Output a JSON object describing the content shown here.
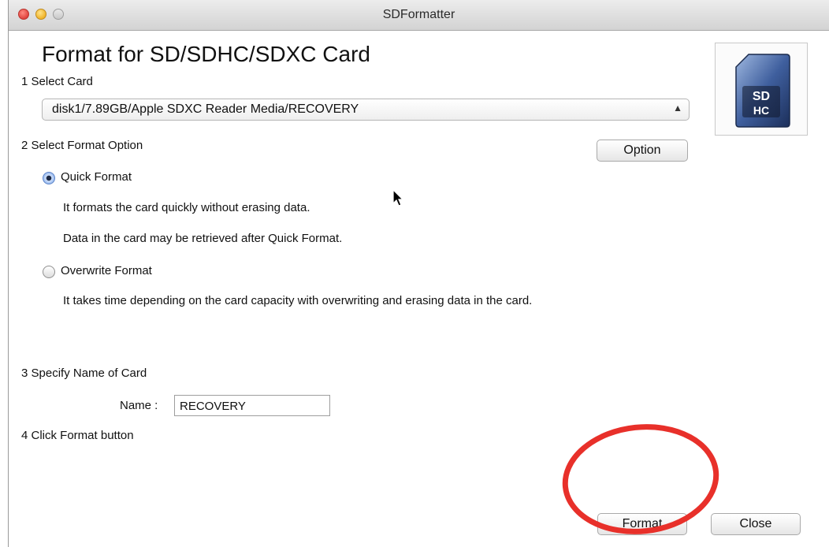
{
  "window": {
    "title": "SDFormatter"
  },
  "header": {
    "title": "Format for SD/SDHC/SDXC Card"
  },
  "step1": {
    "label": "1 Select Card",
    "selected_card": "disk1/7.89GB/Apple SDXC Reader Media/RECOVERY"
  },
  "step2": {
    "label": "2 Select Format Option",
    "option_button": "Option",
    "quick": {
      "label": "Quick Format",
      "selected": true,
      "desc1": "It formats the card quickly without erasing data.",
      "desc2": "Data in the card may be retrieved after Quick Format."
    },
    "overwrite": {
      "label": "Overwrite Format",
      "selected": false,
      "desc": "It takes time depending on the card capacity with overwriting and erasing data in the card."
    }
  },
  "step3": {
    "label": "3 Specify Name of Card",
    "name_label": "Name :",
    "name_value": "RECOVERY"
  },
  "step4": {
    "label": "4 Click Format button"
  },
  "buttons": {
    "format": "Format",
    "close": "Close"
  },
  "sd_logo": {
    "icon": "sd-card-icon",
    "text": "SD HC"
  },
  "colors": {
    "highlight_circle": "#e8302a",
    "radio_selected": "#7fa8ea"
  }
}
